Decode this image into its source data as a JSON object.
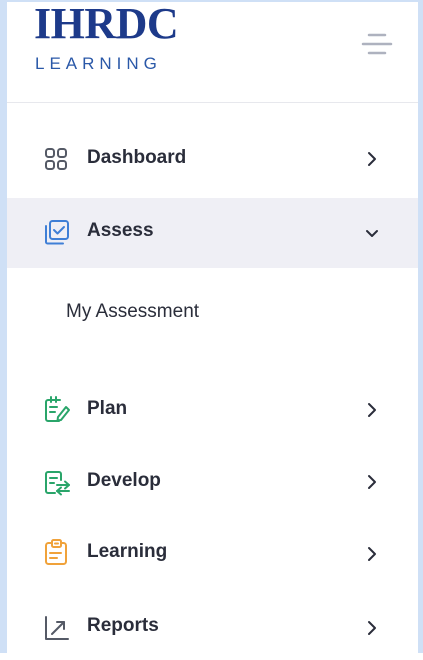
{
  "brand": {
    "name": "IHRDC",
    "tagline": "LEARNING"
  },
  "menu_button_icon": "hamburger-icon",
  "nav": {
    "dashboard": {
      "label": "Dashboard",
      "icon": "grid-icon",
      "expanded": false
    },
    "assess": {
      "label": "Assess",
      "icon": "checklist-icon",
      "expanded": true,
      "subitems": [
        {
          "label": "My Assessment"
        }
      ]
    },
    "plan": {
      "label": "Plan",
      "icon": "edit-list-icon",
      "expanded": false
    },
    "develop": {
      "label": "Develop",
      "icon": "transfer-icon",
      "expanded": false
    },
    "learning": {
      "label": "Learning",
      "icon": "clipboard-icon",
      "expanded": false
    },
    "reports": {
      "label": "Reports",
      "icon": "trend-arrow-icon",
      "expanded": false
    }
  },
  "colors": {
    "brand": "#1d3a8a",
    "active_bg": "#efeff5",
    "assess_icon": "#3f7fd6",
    "plan_icon": "#2aa56a",
    "develop_icon": "#2aa56a",
    "learning_icon": "#f0a23a",
    "text": "#2a2d3a"
  }
}
